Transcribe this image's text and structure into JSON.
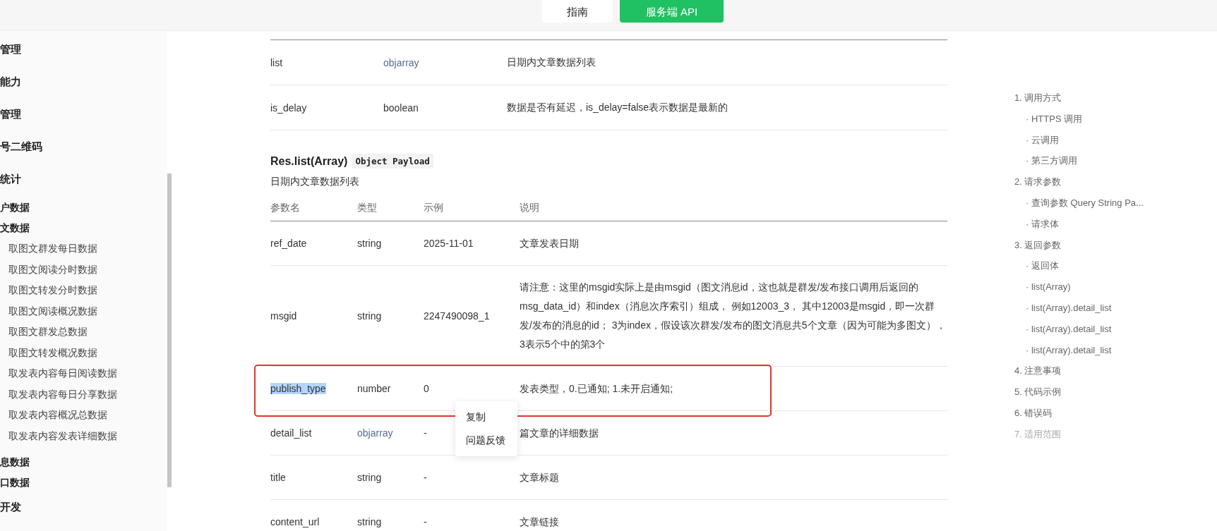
{
  "header": {
    "buttons": [
      {
        "label": "指南",
        "kind": "secondary"
      },
      {
        "label": "服务端 API",
        "kind": "primary"
      }
    ]
  },
  "sidebar": {
    "items": [
      {
        "label": "管理",
        "kind": "section"
      },
      {
        "label": "能力",
        "kind": "section"
      },
      {
        "label": "管理",
        "kind": "section"
      },
      {
        "label": "号二维码",
        "kind": "section"
      },
      {
        "label": "统计",
        "kind": "section"
      },
      {
        "label": "户数据",
        "kind": "group"
      },
      {
        "label": "文数据",
        "kind": "group"
      },
      {
        "label": "取图文群发每日数据",
        "kind": "leaf"
      },
      {
        "label": "取图文阅读分时数据",
        "kind": "leaf"
      },
      {
        "label": "取图文转发分时数据",
        "kind": "leaf"
      },
      {
        "label": "取图文阅读概况数据",
        "kind": "leaf"
      },
      {
        "label": "取图文群发总数据",
        "kind": "leaf"
      },
      {
        "label": "取图文转发概况数据",
        "kind": "leaf"
      },
      {
        "label": "取发表内容每日阅读数据",
        "kind": "leaf"
      },
      {
        "label": "取发表内容每日分享数据",
        "kind": "leaf"
      },
      {
        "label": "取发表内容概况总数据",
        "kind": "leaf"
      },
      {
        "label": "取发表内容发表详细数据",
        "kind": "leaf"
      },
      {
        "label": "息数据",
        "kind": "group"
      },
      {
        "label": "口数据",
        "kind": "group"
      },
      {
        "label": "开发",
        "kind": "section"
      }
    ]
  },
  "response_table": {
    "rows": [
      {
        "name": "list",
        "type": "objarray",
        "type_link": true,
        "description": "日期内文章数据列表"
      },
      {
        "name": "is_delay",
        "type": "boolean",
        "type_link": false,
        "description": "数据是否有延迟，is_delay=false表示数据是最新的"
      }
    ]
  },
  "section": {
    "title": "Res.list(Array)",
    "badge": "Object Payload",
    "description": "日期内文章数据列表"
  },
  "list_table": {
    "columns": [
      "参数名",
      "类型",
      "示例",
      "说明"
    ],
    "rows": [
      {
        "name": "ref_date",
        "type": "string",
        "type_link": false,
        "example": "2025-11-01",
        "description": "文章发表日期",
        "highlighted": false,
        "name_selected": false
      },
      {
        "name": "msgid",
        "type": "string",
        "type_link": false,
        "example": "2247490098_1",
        "description": "请注意：这里的msgid实际上是由msgid（图文消息id，这也就是群发/发布接口调用后返回的msg_data_id）和index（消息次序索引）组成， 例如12003_3， 其中12003是msgid，即一次群发/发布的消息的id； 3为index，假设该次群发/发布的图文消息共5个文章（因为可能为多图文）， 3表示5个中的第3个",
        "highlighted": false,
        "name_selected": false
      },
      {
        "name": "publish_type",
        "type": "number",
        "type_link": false,
        "example": "0",
        "description": "发表类型，0.已通知; 1.未开启通知;",
        "highlighted": true,
        "name_selected": true
      },
      {
        "name": "detail_list",
        "type": "objarray",
        "type_link": true,
        "example": "-",
        "description": "篇文章的详细数据",
        "highlighted": false,
        "name_selected": false
      },
      {
        "name": "title",
        "type": "string",
        "type_link": false,
        "example": "-",
        "description": "文章标题",
        "highlighted": false,
        "name_selected": false
      },
      {
        "name": "content_url",
        "type": "string",
        "type_link": false,
        "example": "-",
        "description": "文章链接",
        "highlighted": false,
        "name_selected": false
      }
    ]
  },
  "context_menu": {
    "items": [
      "复制",
      "问题反馈"
    ]
  },
  "toc": {
    "items": [
      {
        "label": "1. 调用方式",
        "faded": false,
        "children": [
          {
            "label": "· HTTPS 调用"
          },
          {
            "label": "· 云调用"
          },
          {
            "label": "· 第三方调用"
          }
        ]
      },
      {
        "label": "2. 请求参数",
        "faded": false,
        "children": [
          {
            "label": "· 查询参数 Query String Pa..."
          },
          {
            "label": "· 请求体"
          }
        ]
      },
      {
        "label": "3. 返回参数",
        "faded": false,
        "children": [
          {
            "label": "· 返回体"
          },
          {
            "label": "· list(Array)"
          },
          {
            "label": "· list(Array).detail_list"
          },
          {
            "label": "· list(Array).detail_list"
          },
          {
            "label": "· list(Array).detail_list"
          }
        ]
      },
      {
        "label": "4. 注意事项",
        "faded": false
      },
      {
        "label": "5. 代码示例",
        "faded": false
      },
      {
        "label": "6. 错误码",
        "faded": false
      },
      {
        "label": "7. 适用范围",
        "faded": true
      }
    ]
  }
}
